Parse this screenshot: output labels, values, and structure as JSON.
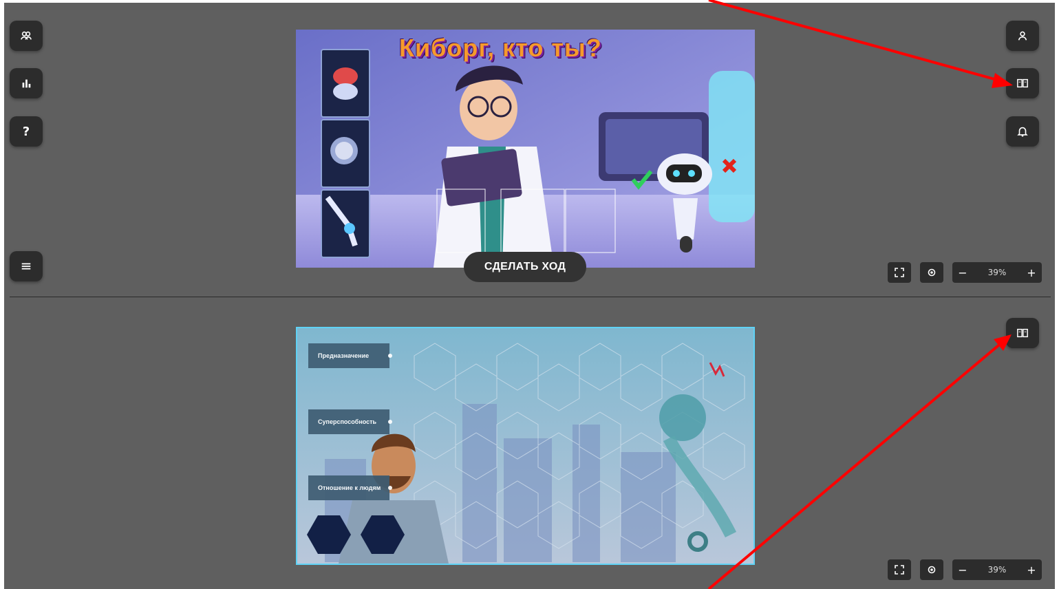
{
  "top_board": {
    "title": "Киборг, кто ты?",
    "make_move_label": "СДЕЛАТЬ ХОД",
    "zoom": {
      "minus": "−",
      "value": "39%",
      "plus": "+"
    }
  },
  "bottom_board": {
    "categories": [
      "Предназначение",
      "Суперспособность",
      "Отношение к людям"
    ],
    "zoom": {
      "minus": "−",
      "value": "39%",
      "plus": "+"
    }
  },
  "icons": {
    "left_top": [
      "users-icon",
      "chart-icon",
      "help-icon"
    ],
    "left_menu": "menu-icon",
    "right_top": [
      "user-icon",
      "map-icon",
      "bell-icon"
    ],
    "right_bottom": "map-icon",
    "help_glyph": "?"
  },
  "colors": {
    "canvas": "#5f5f5f",
    "button": "#2c2c2c",
    "annotation_arrow": "#ff0000"
  }
}
